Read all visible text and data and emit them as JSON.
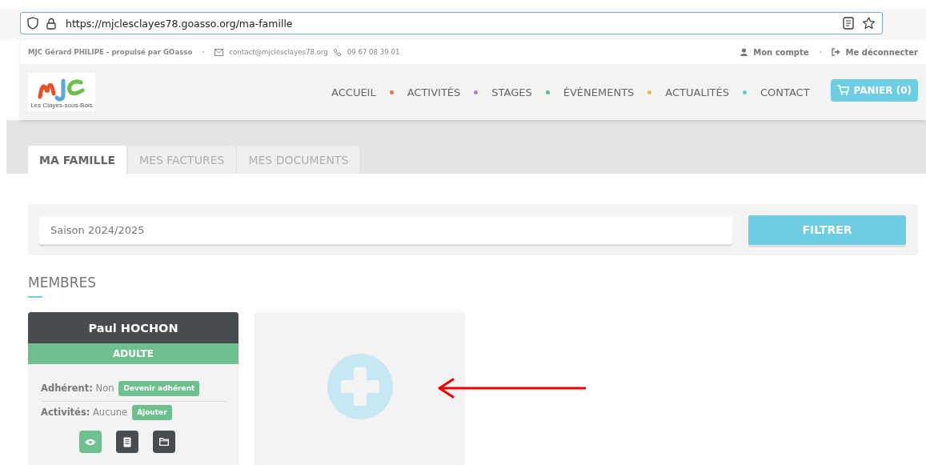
{
  "browser": {
    "url": "https://mjclesclayes78.goasso.org/ma-famille"
  },
  "topbar": {
    "org": "MJC Gérard PHILIPE - propulsé par GOasso",
    "email": "contact@mjclesclayes78.org",
    "phone": "09 67 08 39 01",
    "account": "Mon compte",
    "logout": "Me déconnecter"
  },
  "logo": {
    "caption": "Les Clayes-sous-Bois"
  },
  "nav": [
    {
      "label": "ACCUEIL",
      "color": "#e8734a"
    },
    {
      "label": "ACTIVITÉS",
      "color": "#b77bcf"
    },
    {
      "label": "STAGES",
      "color": "#5cbf85"
    },
    {
      "label": "ÉVÈNEMENTS",
      "color": "#edb73a"
    },
    {
      "label": "ACTUALITÉS",
      "color": "#6cc6dd"
    },
    {
      "label": "CONTACT"
    }
  ],
  "cart": "PANIER (0)",
  "tabs": [
    {
      "label": "MA FAMILLE",
      "selected": true
    },
    {
      "label": "MES FACTURES",
      "selected": false
    },
    {
      "label": "MES DOCUMENTS",
      "selected": false
    }
  ],
  "filter": {
    "value": "Saison 2024/2025",
    "button": "FILTRER"
  },
  "section_title": "MEMBRES",
  "members": [
    {
      "name": "Paul HOCHON",
      "category": "ADULTE",
      "member_label": "Adhérent:",
      "member_value": "Non",
      "member_action": "Devenir adhérent",
      "activities_label": "Activités:",
      "activities_value": "Aucune",
      "activities_action": "Ajouter"
    }
  ]
}
